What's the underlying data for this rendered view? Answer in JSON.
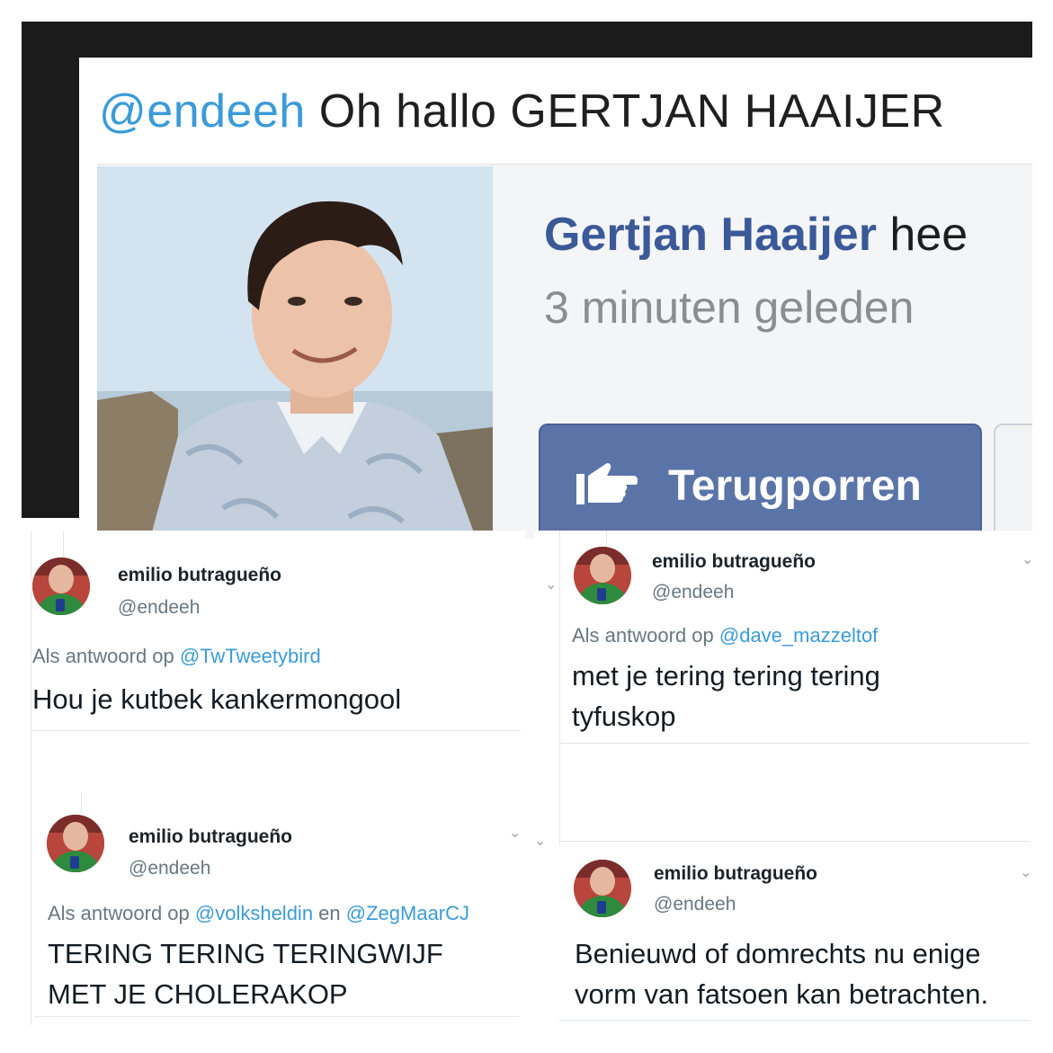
{
  "top_tweet": {
    "mention": "@endeeh",
    "text": " Oh hallo GERTJAN HAAIJER"
  },
  "facebook_notification": {
    "name": "Gertjan Haaijer",
    "action": " hee",
    "time": "3 minuten geleden",
    "button_label": "Terugporren",
    "button_icon": "poke-hand-icon",
    "button_color": "#5b74a8"
  },
  "tweets": [
    {
      "author": "emilio butragueño",
      "handle": "@endeeh",
      "reply_prefix": "Als antwoord op ",
      "reply_to": "@TwTweetybird",
      "reply_join": "",
      "reply_to_2": "",
      "lines": [
        "Hou je kutbek kankermongool"
      ]
    },
    {
      "author": "emilio butragueño",
      "handle": "@endeeh",
      "reply_prefix": "Als antwoord op ",
      "reply_to": "@dave_mazzeltof",
      "reply_join": "",
      "reply_to_2": "",
      "lines": [
        "met je tering tering tering",
        "tyfuskop"
      ]
    },
    {
      "author": "emilio butragueño",
      "handle": "@endeeh",
      "reply_prefix": "Als antwoord op ",
      "reply_to": "@volksheldin",
      "reply_join": " en ",
      "reply_to_2": "@ZegMaarCJ",
      "lines": [
        "TERING TERING TERINGWIJF",
        "MET JE CHOLERAKOP"
      ]
    },
    {
      "author": "emilio butragueño",
      "handle": "@endeeh",
      "reply_prefix": "",
      "reply_to": "",
      "reply_join": "",
      "reply_to_2": "",
      "lines": [
        "Benieuwd of domrechts nu enige",
        "vorm van fatsoen kan betrachten."
      ]
    }
  ],
  "colors": {
    "link": "#3b9bd8",
    "facebook_blue": "#3b5998",
    "muted": "#687782"
  }
}
